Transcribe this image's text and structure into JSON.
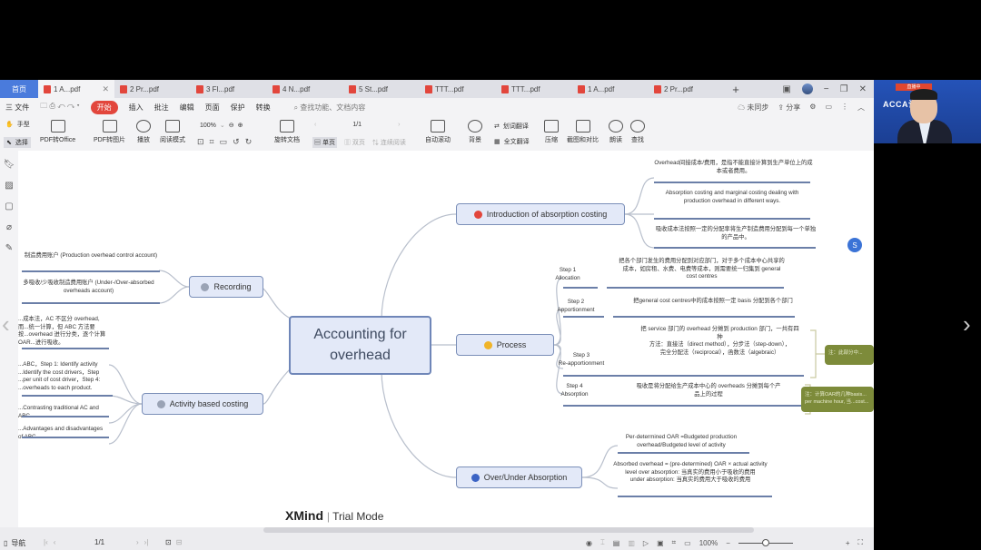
{
  "window": {
    "home_tab": "首页",
    "tabs": [
      {
        "label": "1 A...pdf",
        "active": true
      },
      {
        "label": "2 Pr...pdf"
      },
      {
        "label": "3 Fl...pdf"
      },
      {
        "label": "4 N...pdf"
      },
      {
        "label": "5 St...pdf"
      },
      {
        "label": "TTT...pdf"
      },
      {
        "label": "TTT...pdf"
      },
      {
        "label": "1 A...pdf"
      },
      {
        "label": "2 Pr...pdf"
      }
    ],
    "new_tab": "+"
  },
  "menu": {
    "file": "三 文件",
    "items": [
      "开始",
      "插入",
      "批注",
      "编辑",
      "页面",
      "保护",
      "转换"
    ],
    "search_placeholder": "查找功能、文档内容",
    "sync": "未同步",
    "share": "分享"
  },
  "toolbar": {
    "hand": "手型",
    "select": "选择",
    "pdf_to_office": "PDF转Office",
    "pdf_to_image": "PDF转图片",
    "play": "播放",
    "read_mode": "阅读模式",
    "zoom": "100%",
    "rotate": "旋转文档",
    "page": "1/1",
    "single_page": "单页",
    "double_page": "双页",
    "continuous": "连续阅读",
    "auto_scroll": "自动滚动",
    "background": "背景",
    "word_translate": "划词翻译",
    "full_translate": "全文翻译",
    "compress": "压缩",
    "screenshot_compare": "截图和对比",
    "read_aloud": "朗读",
    "find": "查找"
  },
  "mindmap": {
    "central": [
      "Accounting for",
      "overhead"
    ],
    "branches": {
      "intro": {
        "label": "Introduction of absorption costing",
        "badge_color": "#e2463c",
        "leaves": [
          "Overhead间接成本/费用，是指不能直接计算到生产单位上的成本或者费用。",
          "Absorption costing and marginal costing dealing with production overhead in different ways.",
          "吸收成本法按照一定的分配率将生产制造费用分配到每一个单独的产品中。"
        ]
      },
      "process": {
        "label": "Process",
        "badge_color": "#f0b429",
        "steps": [
          {
            "name": "Step 1\nAllocation",
            "text": "把各个部门发生的费用分配到对应部门，对于多个成本中心共享的成本，如房租、水费、电费等成本，则需要统一归集到 general cost centres"
          },
          {
            "name": "Step 2\nApportionment",
            "text": "把general cost centres中的成本按照一定 basis 分配到各个部门"
          },
          {
            "name": "Step 3\nRe-apportionment",
            "text": "把 service 部门的 overhead 分摊到 production 部门，一共有四种\n方法：直接法（direct method），分步法（step-down），\n完全分配法（reciprocal），函数法（algebraic）"
          },
          {
            "name": "Step 4\nAbsorption",
            "text": "吸收是将分配给生产成本中心的 overheads 分摊到每个产品上的过程"
          }
        ],
        "notes": [
          "注：此部分中...",
          "注：计算OAR的几种basis... per machine hour, 当...cost..."
        ]
      },
      "over_under": {
        "label": "Over/Under Absorption",
        "badge_color": "#3b63c4",
        "leaves": [
          "Per-determined OAR =Budgeted production overhead/Budgeted level of activity",
          "Absorbed overhead = (pre-determined) OAR × actual activity level       over absorption: 当真实的费用小于吸收的费用\nunder absorption: 当真实的费用大于吸收的费用"
        ]
      },
      "recording": {
        "label": "Recording",
        "badge_color": "#9aa3b5",
        "leaves": [
          "制造费用账户 (Production overhead control account)",
          "多吸收/少吸收制造费用账户 (Under-/Over-absorbed overheads account)"
        ]
      },
      "abc": {
        "label": "Activity based costing",
        "badge_color": "#9aa3b5",
        "leaves": [
          "...成本法，AC 不区分 overhead, 而...统一计算，但 ABC 方法要按...overhead 进行分类，逐个计算 OAR...进行吸收。",
          "...ABC，Step 1: Identify activity ...Identify the cost drivers，Step ...per unit of cost driver，Step 4: ...overheads to each product.",
          "...Contrasting traditional AC and ABC",
          "...Advantages and disadvantages of ABC"
        ]
      }
    }
  },
  "watermark": {
    "brand": "XMind",
    "mode": "Trial Mode"
  },
  "statusbar": {
    "nav": "导航",
    "page": "1/1",
    "zoom": "100%",
    "zoom_level_fraction": 0.5
  },
  "video": {
    "banner": "ACCA认证",
    "tag": "直播中"
  }
}
